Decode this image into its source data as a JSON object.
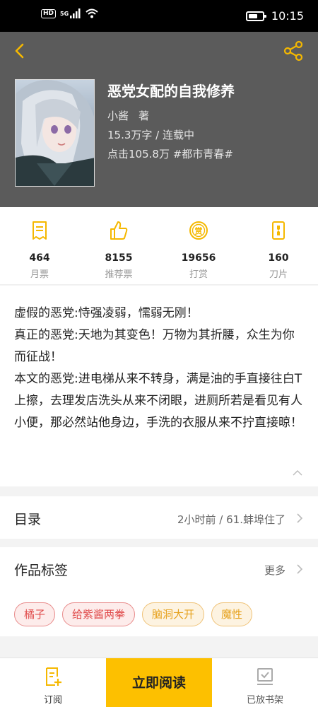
{
  "status_bar": {
    "hd": "HD",
    "network": "5G",
    "time": "10:15",
    "battery_level": 0.65
  },
  "book": {
    "title": "恶党女配的自我修养",
    "author": "小酱",
    "author_suffix": "著",
    "word_count_status": "15.3万字 / 连载中",
    "clicks_genre": "点击105.8万 #都市青春#"
  },
  "stats": [
    {
      "icon": "ticket-icon",
      "value": "464",
      "label": "月票"
    },
    {
      "icon": "thumbs-up-icon",
      "value": "8155",
      "label": "推荐票"
    },
    {
      "icon": "reward-coin-icon",
      "value": "19656",
      "label": "打赏"
    },
    {
      "icon": "blade-icon",
      "value": "160",
      "label": "刀片"
    }
  ],
  "description": [
    "虚假的恶党:恃强凌弱，懦弱无刚！",
    "真正的恶党:天地为其变色！万物为其折腰，众生为你而征战！",
    "本文的恶党:进电梯从来不转身，满是油的手直接往白T上擦，去理发店洗头从来不闭眼，进厕所若是看见有人小便，那必然站他身边，手洗的衣服从来不拧直接晾！"
  ],
  "toc": {
    "label": "目录",
    "latest": "2小时前 / 61.蚌埠住了"
  },
  "tags": {
    "label": "作品标签",
    "more": "更多",
    "items": [
      {
        "text": "橘子",
        "color": "red"
      },
      {
        "text": "给紫酱两拳",
        "color": "red"
      },
      {
        "text": "脑洞大开",
        "color": "orange"
      },
      {
        "text": "魔性",
        "color": "orange"
      }
    ]
  },
  "bottom_bar": {
    "subscribe": "订阅",
    "read_now": "立即阅读",
    "on_shelf": "已放书架"
  },
  "colors": {
    "accent": "#fdc000",
    "icon_yellow": "#f5b800",
    "hero_bg": "#5b5b5b"
  }
}
